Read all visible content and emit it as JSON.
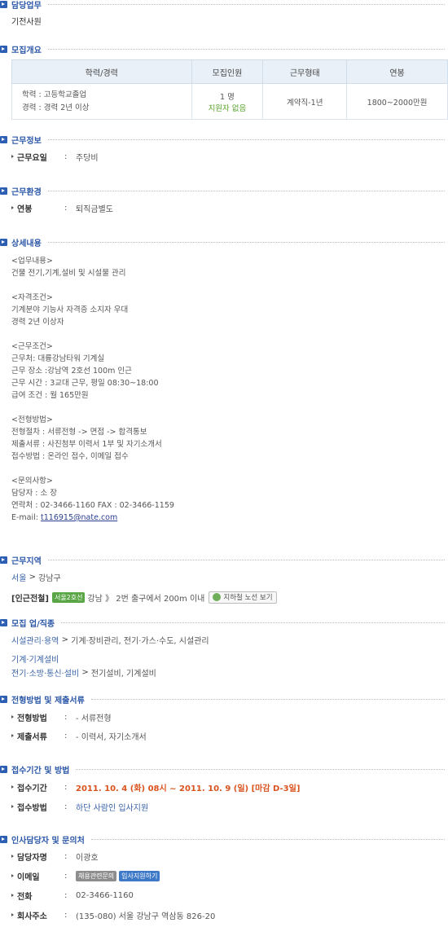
{
  "sections": {
    "duty": "담당업무",
    "overview": "모집개요",
    "work_info": "근무정보",
    "environment": "근무환경",
    "details": "상세내용",
    "location": "근무지역",
    "category": "모집 업/직종",
    "process": "전형방법 및 제출서류",
    "application": "접수기간 및 방법",
    "contact": "인사담당자 및 문의처"
  },
  "duty_value": "기전사원",
  "overview": {
    "headers": [
      "학력/경력",
      "모집인원",
      "근무형태",
      "연봉"
    ],
    "education": "학력 : 고등학교졸업",
    "career": "경력 : 경력 2년 이상",
    "headcount": "1 명",
    "applicants": "지원자 없음",
    "employment_type": "계약직-1년",
    "salary": "1800~2000만원"
  },
  "work_info": {
    "label": "근무요일",
    "value": "주당비"
  },
  "environment": {
    "label": "연봉",
    "value": "퇴직금별도"
  },
  "details": [
    "<업무내용>",
    "건물 전기,기계,설비 및 시설물 관리",
    "",
    "<자격조건>",
    "기계분야 기능사 자격증 소지자 우대",
    "경력 2년 이상자",
    "",
    "<근무조건>",
    "근무처: 대륭강남타워 기계실",
    "근무 장소 :강남역 2호선 100m 인근",
    "근무 시간 : 3교대 근무, 평일 08:30~18:00",
    "급여 조건 : 월 165만원",
    "",
    "<전형방법>",
    "전형절차 : 서류전형 -> 면접 -> 합격통보",
    "제출서류 : 사진첨부 이력서 1부 및 자기소개서",
    "접수방법 : 온라인 접수, 이메일 접수",
    "",
    "<문의사항>",
    "담당자 : 소 장",
    "연락처 : 02-3466-1160 FAX : 02-3466-1159"
  ],
  "email_prefix": "E-mail: ",
  "email": "t116915@nate.com",
  "location": {
    "path_city": "서울",
    "sep": " > ",
    "path_district": "강남구",
    "nearby_label": "[인근전철]",
    "line_tag": "서울2호선",
    "station_text": "강남 》 2번 출구에서 200m 이내",
    "map_button": "지하철 노선 보기"
  },
  "category": {
    "line1_a": "시설관리·용역",
    "line1_sep": " > ",
    "line1_b": "기계·장비관리, 전기·가스·수도, 시설관리",
    "line2": "기계·기계설비",
    "line3_a": "전기·소방·통신·설비",
    "line3_sep": " > ",
    "line3_b": "전기설비, 기계설비"
  },
  "process": {
    "method_label": "전형방법",
    "method_value": "- 서류전형",
    "docs_label": "제출서류",
    "docs_value": "- 이력서, 자기소개서"
  },
  "application": {
    "period_label": "접수기간",
    "period_value": "2011. 10. 4 (화) 08시 ~ 2011. 10. 9 (일) [마감 D-3일]",
    "method_label": "접수방법",
    "method_value": "하단 사람인 입사지원"
  },
  "contact": {
    "name_label": "담당자명",
    "name_value": "이광호",
    "email_label": "이메일",
    "email_btn1": "채용관련문의",
    "email_btn2": "입사지원하기",
    "phone_label": "전화",
    "phone_value": "02-3466-1160",
    "address_label": "회사주소",
    "address_value": "(135-080) 서울 강남구 역삼동 826-20"
  },
  "colon": ":"
}
